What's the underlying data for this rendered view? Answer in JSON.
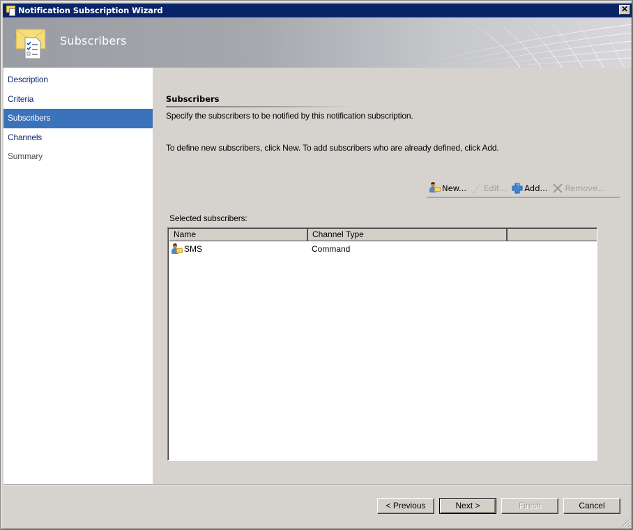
{
  "window": {
    "title": "Notification Subscription Wizard",
    "close_label": "✕"
  },
  "banner": {
    "title": "Subscribers",
    "icon": "envelope-checklist-icon"
  },
  "sidebar": {
    "items": [
      {
        "label": "Description",
        "state": "normal"
      },
      {
        "label": "Criteria",
        "state": "normal"
      },
      {
        "label": "Subscribers",
        "state": "active"
      },
      {
        "label": "Channels",
        "state": "normal"
      },
      {
        "label": "Summary",
        "state": "dim"
      }
    ],
    "active_color": "#3a73b9"
  },
  "main": {
    "section_title": "Subscribers",
    "description": "Specify the subscribers to be notified by this notification subscription.",
    "instructions": "To define new subscribers, click New.  To add subscribers who are already defined, click Add.",
    "toolbar": {
      "new_label": "New...",
      "edit_label": "Edit...",
      "add_label": "Add...",
      "remove_label": "Remove...",
      "edit_enabled": false,
      "remove_enabled": false
    },
    "list_label": "Selected subscribers:",
    "columns": [
      "Name",
      "Channel Type"
    ],
    "rows": [
      {
        "name": "SMS",
        "channel_type": "Command",
        "icon": "subscriber-icon"
      }
    ]
  },
  "footer": {
    "previous_label": "< Previous",
    "next_label": "Next >",
    "finish_label": "Finish",
    "cancel_label": "Cancel",
    "finish_enabled": false
  }
}
